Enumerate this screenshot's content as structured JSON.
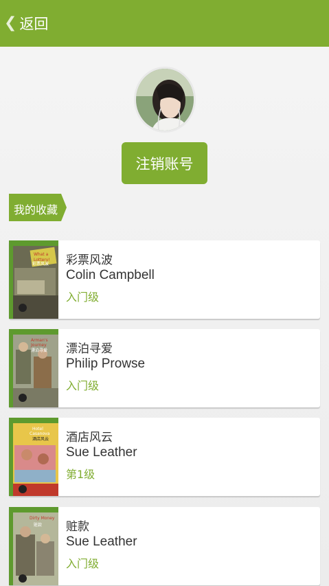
{
  "colors": {
    "accent": "#80ad31",
    "header_bg": "#80ad31",
    "background": "#efefef"
  },
  "header": {
    "back_icon": "chevron-left-icon",
    "back_label": "返回"
  },
  "profile": {
    "logout_label": "注销账号"
  },
  "favorites": {
    "title": "我的收藏",
    "items": [
      {
        "title": "彩票风波",
        "author": "Colin Campbell",
        "level": "入门级",
        "cover_text": "What a Lottery!",
        "cover_cn": "彩票风波"
      },
      {
        "title": "漂泊寻爱",
        "author": "Philip Prowse",
        "level": "入门级",
        "cover_text": "Arman's Journey",
        "cover_cn": "漂泊寻爱"
      },
      {
        "title": "酒店风云",
        "author": "Sue Leather",
        "level": "第1级",
        "cover_text": "Hotel Casanova",
        "cover_cn": "酒店风云"
      },
      {
        "title": "赃款",
        "author": "Sue Leather",
        "level": "入门级",
        "cover_text": "Dirty Money",
        "cover_cn": "赃款"
      }
    ]
  }
}
